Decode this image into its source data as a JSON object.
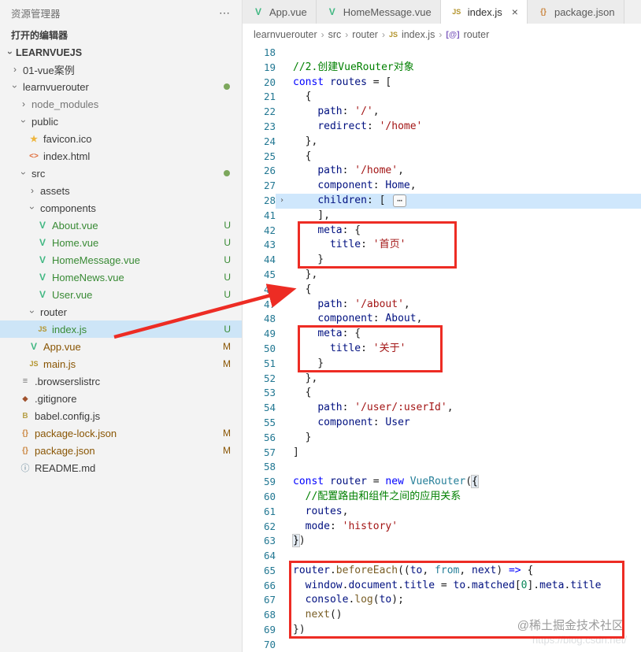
{
  "sidebar": {
    "header": "资源管理器",
    "more_icon": "⋯",
    "open_editors": "打开的编辑器",
    "workspace": "LEARNVUEJS",
    "tree": [
      {
        "label": "01-vue案例",
        "indent": 0,
        "chevron": "right"
      },
      {
        "label": "learnvuerouter",
        "indent": 0,
        "chevron": "down",
        "dot": true
      },
      {
        "label": "node_modules",
        "indent": 1,
        "chevron": "right",
        "dim": true
      },
      {
        "label": "public",
        "indent": 1,
        "chevron": "down"
      },
      {
        "label": "favicon.ico",
        "indent": 2,
        "icon": "ico"
      },
      {
        "label": "index.html",
        "indent": 2,
        "icon": "html"
      },
      {
        "label": "src",
        "indent": 1,
        "chevron": "down",
        "dot": true
      },
      {
        "label": "assets",
        "indent": 2,
        "chevron": "right"
      },
      {
        "label": "components",
        "indent": 2,
        "chevron": "down"
      },
      {
        "label": "About.vue",
        "indent": 3,
        "icon": "vue",
        "badge": "U",
        "status": "untracked"
      },
      {
        "label": "Home.vue",
        "indent": 3,
        "icon": "vue",
        "badge": "U",
        "status": "untracked"
      },
      {
        "label": "HomeMessage.vue",
        "indent": 3,
        "icon": "vue",
        "badge": "U",
        "status": "untracked"
      },
      {
        "label": "HomeNews.vue",
        "indent": 3,
        "icon": "vue",
        "badge": "U",
        "status": "untracked"
      },
      {
        "label": "User.vue",
        "indent": 3,
        "icon": "vue",
        "badge": "U",
        "status": "untracked"
      },
      {
        "label": "router",
        "indent": 2,
        "chevron": "down"
      },
      {
        "label": "index.js",
        "indent": 3,
        "icon": "js",
        "badge": "U",
        "status": "untracked",
        "selected": true
      },
      {
        "label": "App.vue",
        "indent": 2,
        "icon": "vue",
        "badge": "M",
        "status": "modified"
      },
      {
        "label": "main.js",
        "indent": 2,
        "icon": "js",
        "badge": "M",
        "status": "modified"
      },
      {
        "label": ".browserslistrc",
        "indent": 1,
        "icon": "list"
      },
      {
        "label": ".gitignore",
        "indent": 1,
        "icon": "git"
      },
      {
        "label": "babel.config.js",
        "indent": 1,
        "icon": "babel"
      },
      {
        "label": "package-lock.json",
        "indent": 1,
        "icon": "json",
        "badge": "M",
        "status": "modified"
      },
      {
        "label": "package.json",
        "indent": 1,
        "icon": "json",
        "badge": "M",
        "status": "modified"
      },
      {
        "label": "README.md",
        "indent": 1,
        "icon": "info"
      }
    ]
  },
  "tabs": [
    {
      "label": "App.vue",
      "icon": "vue",
      "active": false,
      "close": false
    },
    {
      "label": "HomeMessage.vue",
      "icon": "vue",
      "active": false,
      "close": false
    },
    {
      "label": "index.js",
      "icon": "js",
      "active": true,
      "close": true
    },
    {
      "label": "package.json",
      "icon": "json",
      "active": false,
      "close": false
    }
  ],
  "breadcrumb": {
    "path": [
      "learnvuerouter",
      "src",
      "router"
    ],
    "file": {
      "label": "index.js",
      "icon": "js"
    },
    "symbol": {
      "label": "router",
      "icon": "symbol"
    }
  },
  "editor": {
    "lines": [
      {
        "n": "18",
        "tokens": []
      },
      {
        "n": "19",
        "tokens": [
          [
            "cmt",
            "//2.创建VueRouter对象"
          ]
        ]
      },
      {
        "n": "20",
        "tokens": [
          [
            "kw",
            "const"
          ],
          [
            "pl",
            " "
          ],
          [
            "var",
            "routes"
          ],
          [
            "pl",
            " = ["
          ]
        ]
      },
      {
        "n": "21",
        "tokens": [
          [
            "pl",
            "  {"
          ]
        ]
      },
      {
        "n": "22",
        "tokens": [
          [
            "pl",
            "    "
          ],
          [
            "var",
            "path"
          ],
          [
            "pl",
            ": "
          ],
          [
            "str",
            "'/'"
          ],
          [
            "pl",
            ","
          ]
        ]
      },
      {
        "n": "23",
        "tokens": [
          [
            "pl",
            "    "
          ],
          [
            "var",
            "redirect"
          ],
          [
            "pl",
            ": "
          ],
          [
            "str",
            "'/home'"
          ]
        ]
      },
      {
        "n": "24",
        "tokens": [
          [
            "pl",
            "  },"
          ]
        ]
      },
      {
        "n": "25",
        "tokens": [
          [
            "pl",
            "  {"
          ]
        ]
      },
      {
        "n": "26",
        "tokens": [
          [
            "pl",
            "    "
          ],
          [
            "var",
            "path"
          ],
          [
            "pl",
            ": "
          ],
          [
            "str",
            "'/home'"
          ],
          [
            "pl",
            ","
          ]
        ]
      },
      {
        "n": "27",
        "tokens": [
          [
            "pl",
            "    "
          ],
          [
            "var",
            "component"
          ],
          [
            "pl",
            ": "
          ],
          [
            "var",
            "Home"
          ],
          [
            "pl",
            ","
          ]
        ]
      },
      {
        "n": "28",
        "hl": true,
        "fold": true,
        "tokens": [
          [
            "pl",
            "    "
          ],
          [
            "var",
            "children"
          ],
          [
            "pl",
            ": [ "
          ],
          [
            "fold",
            "⋯"
          ]
        ]
      },
      {
        "n": "41",
        "tokens": [
          [
            "pl",
            "    ],"
          ]
        ]
      },
      {
        "n": "42",
        "tokens": [
          [
            "pl",
            "    "
          ],
          [
            "var",
            "meta"
          ],
          [
            "pl",
            ": {"
          ]
        ]
      },
      {
        "n": "43",
        "tokens": [
          [
            "pl",
            "      "
          ],
          [
            "var",
            "title"
          ],
          [
            "pl",
            ": "
          ],
          [
            "str",
            "'首页'"
          ]
        ]
      },
      {
        "n": "44",
        "tokens": [
          [
            "pl",
            "    }"
          ]
        ]
      },
      {
        "n": "45",
        "tokens": [
          [
            "pl",
            "  },"
          ]
        ]
      },
      {
        "n": "46",
        "tokens": [
          [
            "pl",
            "  {"
          ]
        ]
      },
      {
        "n": "47",
        "tokens": [
          [
            "pl",
            "    "
          ],
          [
            "var",
            "path"
          ],
          [
            "pl",
            ": "
          ],
          [
            "str",
            "'/about'"
          ],
          [
            "pl",
            ","
          ]
        ]
      },
      {
        "n": "48",
        "tokens": [
          [
            "pl",
            "    "
          ],
          [
            "var",
            "component"
          ],
          [
            "pl",
            ": "
          ],
          [
            "var",
            "About"
          ],
          [
            "pl",
            ","
          ]
        ]
      },
      {
        "n": "49",
        "tokens": [
          [
            "pl",
            "    "
          ],
          [
            "var",
            "meta"
          ],
          [
            "pl",
            ": {"
          ]
        ]
      },
      {
        "n": "50",
        "tokens": [
          [
            "pl",
            "      "
          ],
          [
            "var",
            "title"
          ],
          [
            "pl",
            ": "
          ],
          [
            "str",
            "'关于'"
          ]
        ]
      },
      {
        "n": "51",
        "tokens": [
          [
            "pl",
            "    }"
          ]
        ]
      },
      {
        "n": "52",
        "tokens": [
          [
            "pl",
            "  },"
          ]
        ]
      },
      {
        "n": "53",
        "tokens": [
          [
            "pl",
            "  {"
          ]
        ]
      },
      {
        "n": "54",
        "tokens": [
          [
            "pl",
            "    "
          ],
          [
            "var",
            "path"
          ],
          [
            "pl",
            ": "
          ],
          [
            "str",
            "'/user/:userId'"
          ],
          [
            "pl",
            ","
          ]
        ]
      },
      {
        "n": "55",
        "tokens": [
          [
            "pl",
            "    "
          ],
          [
            "var",
            "component"
          ],
          [
            "pl",
            ": "
          ],
          [
            "var",
            "User"
          ]
        ]
      },
      {
        "n": "56",
        "tokens": [
          [
            "pl",
            "  }"
          ]
        ]
      },
      {
        "n": "57",
        "tokens": [
          [
            "pl",
            "]"
          ]
        ]
      },
      {
        "n": "58",
        "tokens": []
      },
      {
        "n": "59",
        "tokens": [
          [
            "kw",
            "const"
          ],
          [
            "pl",
            " "
          ],
          [
            "var",
            "router"
          ],
          [
            "pl",
            " = "
          ],
          [
            "kw",
            "new"
          ],
          [
            "pl",
            " "
          ],
          [
            "cls",
            "VueRouter"
          ],
          [
            "pl",
            "("
          ],
          [
            "brk",
            "{"
          ]
        ]
      },
      {
        "n": "60",
        "tokens": [
          [
            "pl",
            "  "
          ],
          [
            "cmt",
            "//配置路由和组件之间的应用关系"
          ]
        ]
      },
      {
        "n": "61",
        "tokens": [
          [
            "pl",
            "  "
          ],
          [
            "var",
            "routes"
          ],
          [
            "pl",
            ","
          ]
        ]
      },
      {
        "n": "62",
        "tokens": [
          [
            "pl",
            "  "
          ],
          [
            "var",
            "mode"
          ],
          [
            "pl",
            ": "
          ],
          [
            "str",
            "'history'"
          ]
        ]
      },
      {
        "n": "63",
        "tokens": [
          [
            "brk",
            "}"
          ],
          [
            "pl",
            ")"
          ]
        ]
      },
      {
        "n": "64",
        "tokens": []
      },
      {
        "n": "65",
        "tokens": [
          [
            "var",
            "router"
          ],
          [
            "pl",
            "."
          ],
          [
            "fn",
            "beforeEach"
          ],
          [
            "pl",
            "(("
          ],
          [
            "var",
            "to"
          ],
          [
            "pl",
            ", "
          ],
          [
            "cls",
            "from"
          ],
          [
            "pl",
            ", "
          ],
          [
            "var",
            "next"
          ],
          [
            "pl",
            ") "
          ],
          [
            "kw",
            "=>"
          ],
          [
            "pl",
            " {"
          ]
        ]
      },
      {
        "n": "66",
        "tokens": [
          [
            "pl",
            "  "
          ],
          [
            "var",
            "window"
          ],
          [
            "pl",
            "."
          ],
          [
            "var",
            "document"
          ],
          [
            "pl",
            "."
          ],
          [
            "var",
            "title"
          ],
          [
            "pl",
            " = "
          ],
          [
            "var",
            "to"
          ],
          [
            "pl",
            "."
          ],
          [
            "var",
            "matched"
          ],
          [
            "pl",
            "["
          ],
          [
            "num",
            "0"
          ],
          [
            "pl",
            "]."
          ],
          [
            "var",
            "meta"
          ],
          [
            "pl",
            "."
          ],
          [
            "var",
            "title"
          ]
        ]
      },
      {
        "n": "67",
        "tokens": [
          [
            "pl",
            "  "
          ],
          [
            "var",
            "console"
          ],
          [
            "pl",
            "."
          ],
          [
            "fn",
            "log"
          ],
          [
            "pl",
            "("
          ],
          [
            "var",
            "to"
          ],
          [
            "pl",
            ");"
          ]
        ]
      },
      {
        "n": "68",
        "tokens": [
          [
            "pl",
            "  "
          ],
          [
            "fn",
            "next"
          ],
          [
            "pl",
            "()"
          ]
        ]
      },
      {
        "n": "69",
        "tokens": [
          [
            "pl",
            "})"
          ]
        ]
      },
      {
        "n": "70",
        "tokens": []
      }
    ]
  },
  "annotation_color": "#ed2c24",
  "watermark": {
    "line1": "@稀土掘金技术社区",
    "line2": "https://blog.csdn.net/"
  }
}
